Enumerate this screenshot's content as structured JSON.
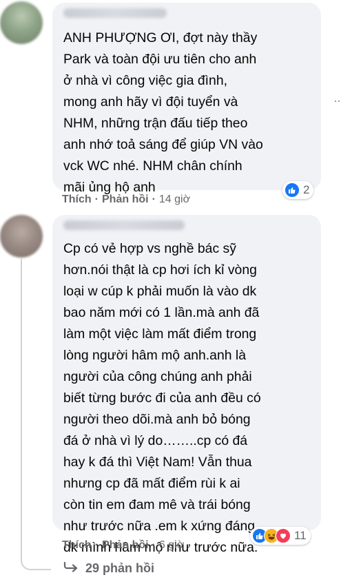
{
  "comments": [
    {
      "text": "ANH PHƯỢNG ƠI, đợt này thầy\nPark và toàn đội ưu tiên cho anh\nở nhà vì công việc gia đình,\nmong anh hãy vì đội tuyển và\nNHM, những trận đấu tiếp theo\nanh nhớ toả sáng để giúp VN vào\nvck WC nhé. NHM chân chính\nmãi ủng hộ anh",
      "like_label": "Thích",
      "reply_label": "Phản hồi",
      "time": "14 giờ",
      "reaction_count": "2",
      "reaction_icons": [
        "like-icon"
      ]
    },
    {
      "text": "Cp có vẻ hợp vs nghề bác sỹ\nhơn.nói thật là cp hơi ích kỉ vòng\nloại w cúp k phải muốn là vào dk\nbao năm mới có 1 lần.mà anh đã\nlàm một việc làm mất điểm trong\nlòng người hâm mộ anh.anh là\nngười của công chúng anh phải\nbiết từng bước đi của anh đều có\nngười theo dõi.mà anh bỏ bóng\nđá ở nhà vì lý do……..cp có đá\nhay k đá thì Việt Nam! Vẫn thua\nnhưng cp đã mất điểm rùi k ai\ncòn tin em đam mê và trái bóng\nnhư trước nữa .em k xứng đáng\ndk mình hâm mộ như trước nữa.",
      "like_label": "Thích",
      "reply_label": "Phản hồi",
      "time": "6 giờ",
      "reaction_count": "11",
      "reaction_icons": [
        "like-icon",
        "haha-icon",
        "love-icon"
      ]
    }
  ],
  "separator": "·",
  "more_options": "···",
  "replies_link": {
    "icon": "reply-arrow-icon",
    "label": "29 phản hồi"
  },
  "colors": {
    "bubble": "#f0f2f5",
    "secondary_text": "#65676b",
    "like_blue": "#1877f2",
    "haha_yellow": "#f7b125",
    "love_red": "#f33e58"
  }
}
